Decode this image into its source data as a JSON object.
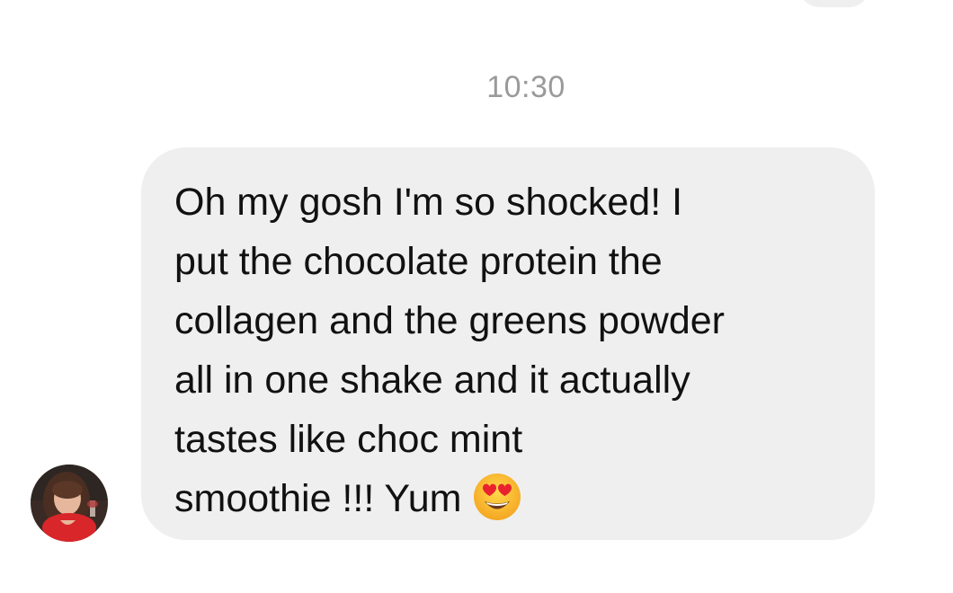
{
  "conversation": {
    "timestamp": "10:30",
    "message": {
      "sender_avatar_icon": "avatar-photo",
      "lines": [
        "Oh my gosh I'm so shocked! I",
        "put the chocolate protein the",
        "collagen and the greens powder",
        "all in one shake and it actually",
        "tastes like choc mint",
        "smoothie !!! Yum"
      ],
      "emoji": "heart-eyes-emoji"
    }
  },
  "colors": {
    "bubble": "#efefef",
    "timestamp": "#9a9a9a",
    "text": "#111111",
    "background": "#ffffff"
  }
}
